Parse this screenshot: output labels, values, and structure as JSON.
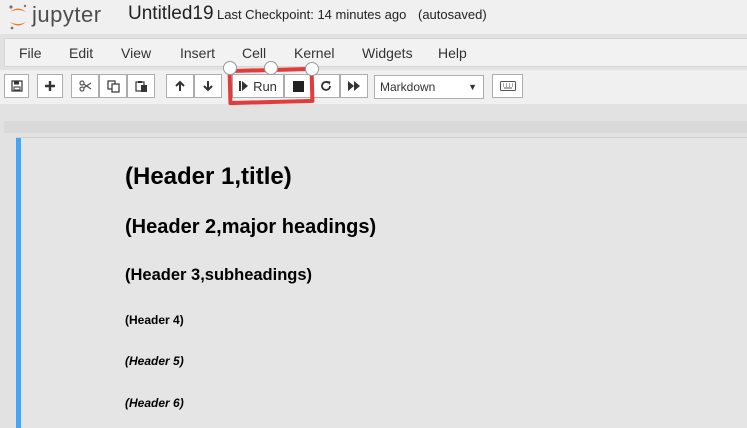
{
  "header": {
    "logo_text": "jupyter",
    "notebook_title": "Untitled19",
    "checkpoint": "Last Checkpoint: 14 minutes ago",
    "autosave": "(autosaved)"
  },
  "menu": {
    "items": [
      {
        "label": "File"
      },
      {
        "label": "Edit"
      },
      {
        "label": "View"
      },
      {
        "label": "Insert"
      },
      {
        "label": "Cell"
      },
      {
        "label": "Kernel"
      },
      {
        "label": "Widgets"
      },
      {
        "label": "Help"
      }
    ]
  },
  "toolbar": {
    "run_label": "Run",
    "cell_type": "Markdown",
    "highlight_color": "#e23b3b"
  },
  "cell": {
    "accent_color": "#42a5f5",
    "headings": [
      "(Header 1,title)",
      "(Header 2,major headings)",
      "(Header 3,subheadings)",
      "(Header 4)",
      "(Header 5)",
      "(Header 6)"
    ]
  }
}
